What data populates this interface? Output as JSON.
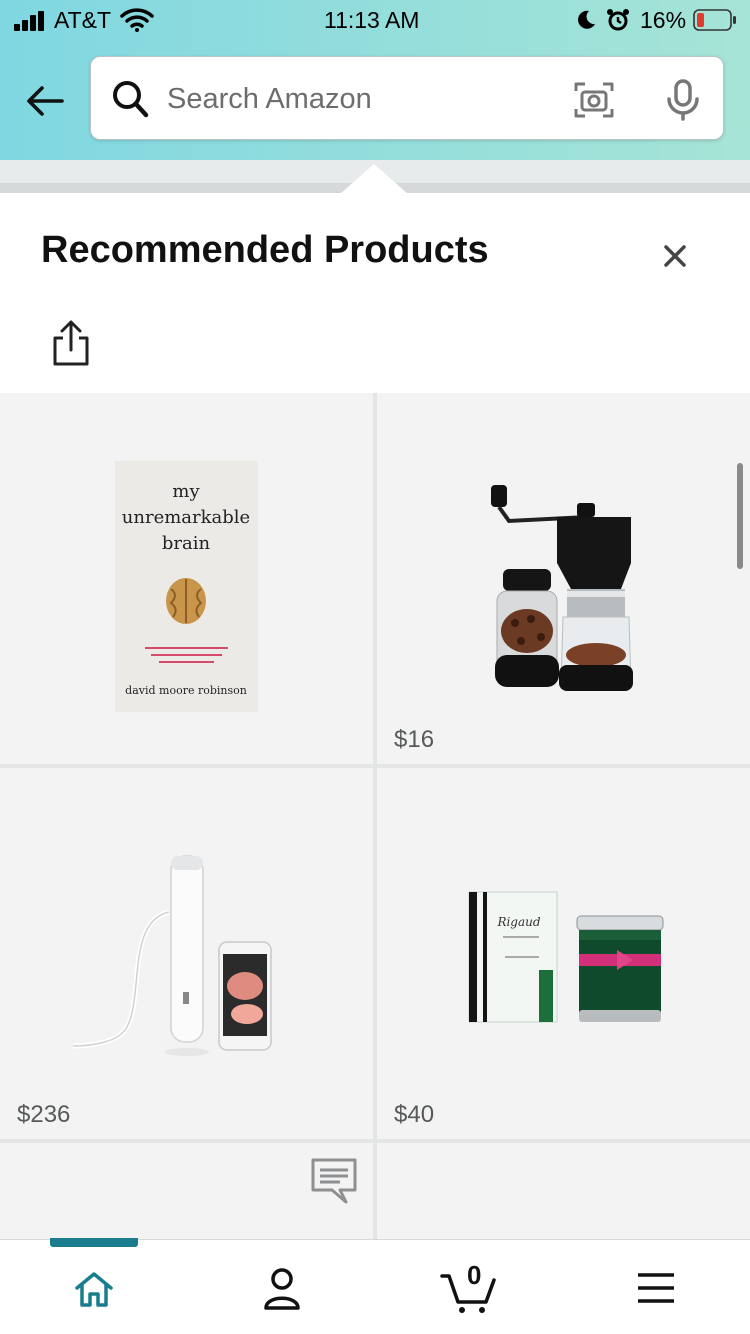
{
  "status_bar": {
    "carrier": "AT&T",
    "time": "11:13 AM",
    "battery": "16%"
  },
  "search": {
    "placeholder": "Search Amazon"
  },
  "panel": {
    "title": "Recommended Products"
  },
  "products": [
    {
      "price": "",
      "cover": {
        "line1": "my",
        "line2": "unremarkable",
        "line3": "brain",
        "author": "david moore robinson"
      }
    },
    {
      "price": "$16"
    },
    {
      "price": "$236"
    },
    {
      "price": "$40",
      "brand": "Rigaud"
    }
  ],
  "tabbar": {
    "cart_count": "0",
    "active_tab": "home"
  },
  "colors": {
    "header_start": "#80d7e1",
    "header_end": "#a6e4d6",
    "accent": "#1a7d8e",
    "battery_low": "#e03b2f",
    "price_text": "#565959"
  },
  "icons": [
    "back-arrow-icon",
    "search-icon",
    "camera-icon",
    "mic-icon",
    "close-icon",
    "share-icon",
    "chat-icon",
    "home-icon",
    "account-icon",
    "cart-icon",
    "menu-icon"
  ]
}
